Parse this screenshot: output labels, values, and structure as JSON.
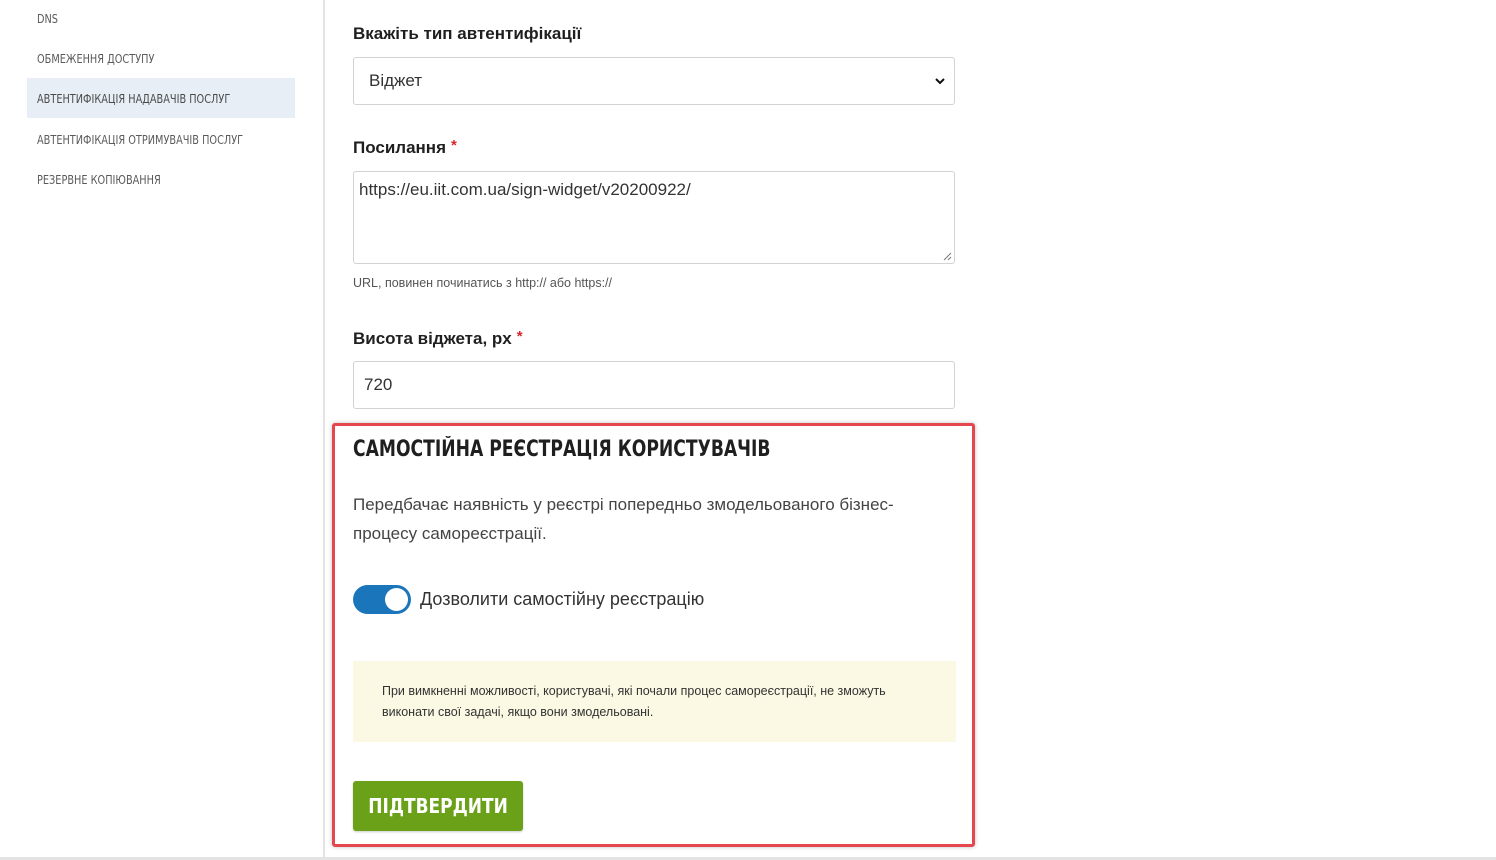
{
  "sidebar": {
    "items": [
      {
        "label": "DNS",
        "active": false
      },
      {
        "label": "Обмеження доступу",
        "active": false
      },
      {
        "label": "Автентифікація надавачів послуг",
        "active": true
      },
      {
        "label": "Автентифікація отримувачів послуг",
        "active": false
      },
      {
        "label": "Резервне копіювання",
        "active": false
      }
    ]
  },
  "form": {
    "auth_type": {
      "label": "Вкажіть тип автентифікації",
      "value": "Віджет"
    },
    "link": {
      "label": "Посилання",
      "required_mark": "*",
      "value": "https://eu.iit.com.ua/sign-widget/v20200922/",
      "hint": "URL, повинен починатись з http:// або https://"
    },
    "height": {
      "label": "Висота віджета, px",
      "required_mark": "*",
      "value": "720"
    }
  },
  "self_registration": {
    "title": "САМОСТІЙНА РЕЄСТРАЦІЯ КОРИСТУВАЧІВ",
    "description": "Передбачає наявність у реєстрі попередньо змодельованого бізнес-процесу самореєстрації.",
    "toggle": {
      "label": "Дозволити самостійну реєстрацію",
      "checked": true
    },
    "note": "При вимкненні можливості, користувачі, які почали процес самореєстрації, не зможуть виконати свої задачі, якщо вони змодельовані.",
    "submit_label": "ПІДТВЕРДИТИ"
  },
  "colors": {
    "toggle_on": "#1b75bb",
    "submit": "#6aa119",
    "highlight_border": "#e5474f",
    "note_bg": "#fbf8e3",
    "active_nav_bg": "#e7eef5",
    "required": "#d9262c"
  }
}
